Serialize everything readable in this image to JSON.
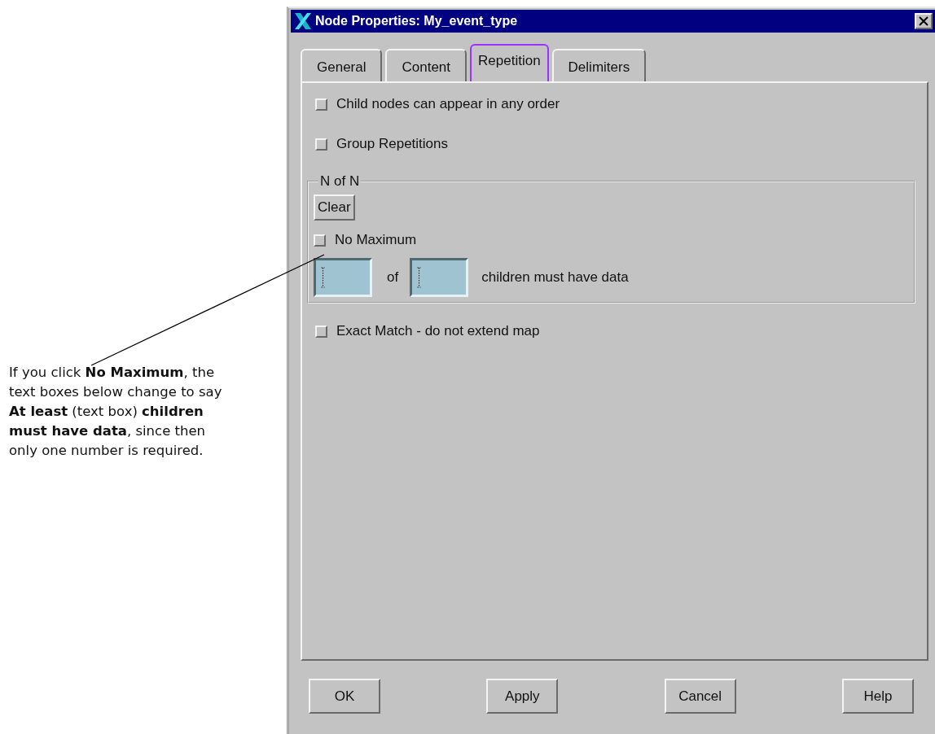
{
  "callout": {
    "text": "If you click **No Maximum**, the text boxes below change to say **At least** (text box) **children must have data**, since then only one number is required."
  },
  "window": {
    "title": "Node Properties: My_event_type"
  },
  "tabs": [
    {
      "label": "General",
      "selected": false
    },
    {
      "label": "Content",
      "selected": false
    },
    {
      "label": "Repetition",
      "selected": true
    },
    {
      "label": "Delimiters",
      "selected": false
    }
  ],
  "options": [
    {
      "label": "Child nodes can appear in any order",
      "checked": false
    },
    {
      "label": "Group Repetitions",
      "checked": false
    }
  ],
  "group": {
    "title": "N of N",
    "clear_button": "Clear",
    "no_maximum": {
      "label": "No Maximum",
      "checked": false
    },
    "of_label": "of",
    "suffix": "children must have data"
  },
  "exact_match": {
    "label": "Exact Match - do not extend map",
    "checked": false
  },
  "buttons": [
    "OK",
    "Apply",
    "Cancel",
    "Help"
  ]
}
